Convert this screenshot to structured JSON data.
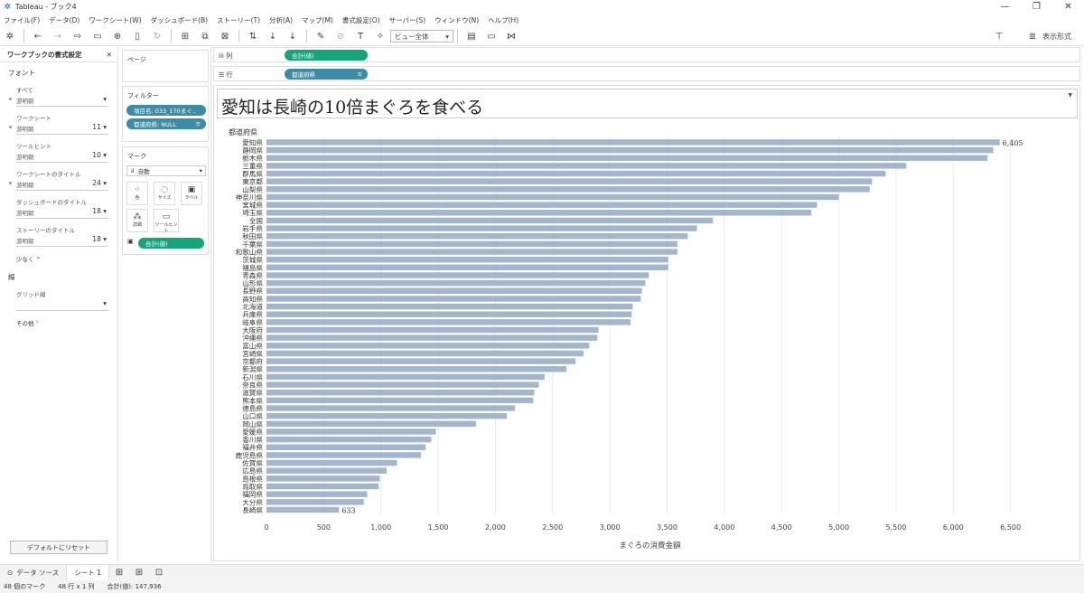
{
  "window": {
    "title": "Tableau - ブック4",
    "minimize": "—",
    "restore": "❐",
    "close": "✕"
  },
  "menu": [
    "ファイル(F)",
    "データ(D)",
    "ワークシート(W)",
    "ダッシュボード(B)",
    "ストーリー(T)",
    "分析(A)",
    "マップ(M)",
    "書式設定(O)",
    "サーバー(S)",
    "ウィンドウ(N)",
    "ヘルプ(H)"
  ],
  "toolbar": {
    "view_select": "ビュー全体",
    "show_me": "表示形式"
  },
  "format_pane": {
    "title": "ワークブックの書式設定",
    "close": "✕",
    "font_section": "フォント",
    "items": [
      {
        "label": "すべて",
        "value": "游明朝",
        "size": ""
      },
      {
        "label": "ワークシート",
        "value": "游明朝",
        "size": "11"
      },
      {
        "label": "ツールヒント",
        "value": "游明朝",
        "size": "10"
      },
      {
        "label": "ワークシートのタイトル",
        "value": "游明朝",
        "size": "24"
      },
      {
        "label": "ダッシュボードのタイトル",
        "value": "游明朝",
        "size": "18"
      },
      {
        "label": "ストーリーのタイトル",
        "value": "游明朝",
        "size": "18"
      }
    ],
    "less": "少なく ^",
    "line_section": "線",
    "grid_label": "グリッド線",
    "other": "その他 ˅",
    "reset": "デフォルトにリセット"
  },
  "shelves": {
    "pages": "ページ",
    "filters": "フィルター",
    "filter_pills": [
      "項目名: 033_170まぐ..",
      "都道府県: NULL"
    ],
    "marks": "マーク",
    "mark_type": "自動",
    "mark_buttons": [
      "色",
      "サイズ",
      "ラベル",
      "詳細",
      "ツールヒント"
    ],
    "mark_pill": "合計(値)",
    "columns_label": "列",
    "rows_label": "行",
    "columns_pill": "合計(値)",
    "rows_pill": "都道府県"
  },
  "viz_title": "愛知は長崎の10倍まぐろを食べる",
  "chart_data": {
    "type": "bar",
    "orientation": "horizontal",
    "row_header": "都道府県",
    "xlabel": "まぐろの消費金額",
    "xlim": [
      0,
      6700
    ],
    "xticks": [
      0,
      500,
      1000,
      1500,
      2000,
      2500,
      3000,
      3500,
      4000,
      4500,
      5000,
      5500,
      6000,
      6500
    ],
    "xtick_labels": [
      "0",
      "500",
      "1,000",
      "1,500",
      "2,000",
      "2,500",
      "3,000",
      "3,500",
      "4,000",
      "4,500",
      "5,000",
      "5,500",
      "6,000",
      "6,500"
    ],
    "bar_color": "#a4b6cb",
    "grid": true,
    "categories": [
      "愛知県",
      "静岡県",
      "栃木県",
      "三重県",
      "群馬県",
      "東京都",
      "山梨県",
      "神奈川県",
      "宮城県",
      "埼玉県",
      "全国",
      "岩手県",
      "秋田県",
      "千葉県",
      "和歌山県",
      "茨城県",
      "福島県",
      "青森県",
      "山形県",
      "長野県",
      "高知県",
      "北海道",
      "兵庫県",
      "岐阜県",
      "大阪府",
      "沖縄県",
      "富山県",
      "宮崎県",
      "京都府",
      "新潟県",
      "石川県",
      "奈良県",
      "滋賀県",
      "熊本県",
      "徳島県",
      "山口県",
      "岡山県",
      "愛媛県",
      "香川県",
      "福井県",
      "鹿児島県",
      "佐賀県",
      "広島県",
      "島根県",
      "鳥取県",
      "福岡県",
      "大分県",
      "長崎県"
    ],
    "values": [
      6405,
      6350,
      6300,
      5590,
      5410,
      5290,
      5270,
      5000,
      4810,
      4760,
      3900,
      3760,
      3680,
      3590,
      3590,
      3510,
      3510,
      3340,
      3310,
      3280,
      3270,
      3200,
      3190,
      3180,
      2900,
      2890,
      2820,
      2770,
      2700,
      2620,
      2430,
      2380,
      2340,
      2330,
      2170,
      2100,
      1830,
      1480,
      1440,
      1390,
      1350,
      1140,
      1050,
      990,
      980,
      880,
      850,
      633
    ],
    "data_labels": [
      {
        "category": "愛知県",
        "text": "6,405"
      },
      {
        "category": "長崎県",
        "text": "633"
      }
    ]
  },
  "tabs": {
    "datasource": "データ ソース",
    "sheet": "シート 1"
  },
  "status": {
    "marks": "48 個のマーク",
    "dims": "48 行 x 1 列",
    "sum": "合計(値): 147,936"
  }
}
